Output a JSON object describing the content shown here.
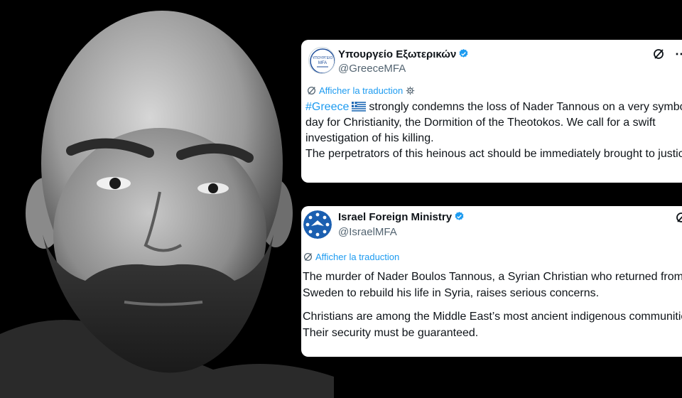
{
  "greece_tweet": {
    "display_name": "Υπουργείο Εξωτερικών",
    "handle": "@GreeceMFA",
    "avatar_text_line1": "ΥΠΟΥΡΓΕΙΟ",
    "avatar_text_line2": "MFA",
    "translate_label": "Afficher la traduction",
    "hashtag": "#Greece",
    "body_part1": "strongly condemns the loss of Nader Tannous on a very symbolic day for Christianity, the Dormition of the Theotokos. We call for a swift investigation of his killing.",
    "body_part2": "The perpetrators of this heinous act should be immediately brought to justice.",
    "icons": [
      "grok-icon",
      "more-icon",
      "verified-icon",
      "settings-icon",
      "greek-flag-icon"
    ]
  },
  "israel_tweet": {
    "display_name": "Israel Foreign Ministry",
    "handle": "@IsraelMFA",
    "translate_label": "Afficher la traduction",
    "body_para1": "The murder of Nader Boulos Tannous, a Syrian Christian who returned from Sweden to rebuild his life in Syria, raises serious concerns.",
    "body_para2": "Christians are among the Middle East’s most ancient indigenous communities. Their security must be guaranteed.",
    "icons": [
      "grok-icon",
      "verified-icon"
    ]
  },
  "colors": {
    "background": "#000000",
    "link_blue": "#1d9bf0",
    "verified_blue": "#1d9bf0",
    "text": "#0f1419",
    "muted": "#536471",
    "israel_logo_blue": "#1b5fb0"
  }
}
